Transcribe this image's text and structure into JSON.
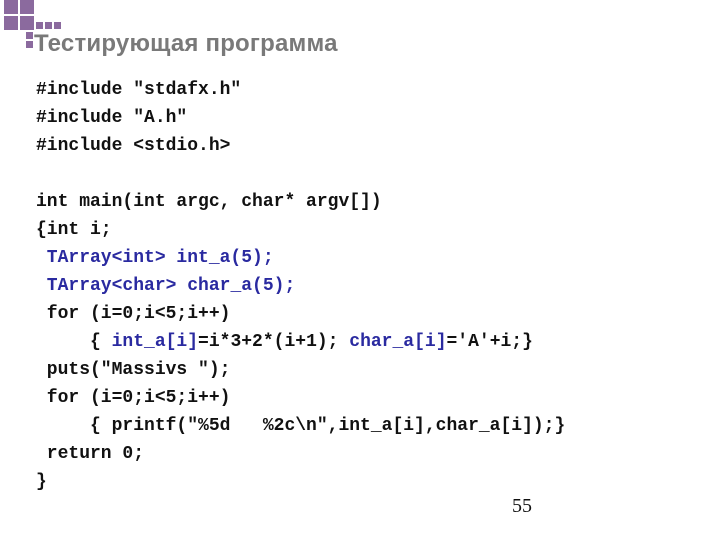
{
  "title": "Тестирующая программа",
  "page_number": "55",
  "code": {
    "l1": "#include \"stdafx.h\"",
    "l2": "#include \"A.h\"",
    "l3": "#include <stdio.h>",
    "l4": "",
    "l5": "int main(int argc, char* argv[])",
    "l6": "{int i;",
    "l7a": " TArray<int>",
    "l7b": " int_a(5);",
    "l8a": " TArray<char>",
    "l8b": " char_a(5);",
    "l9": " for (i=0;i<5;i++)",
    "l10a": "     { ",
    "l10b": "int_a[i]",
    "l10c": "=i*3+2*(i+1); ",
    "l10d": "char_a[i]",
    "l10e": "='A'+i;}",
    "l11": " puts(\"Massivs \");",
    "l12": " for (i=0;i<5;i++)",
    "l13": "     { printf(\"%5d   %2c\\n\",int_a[i],char_a[i]);}",
    "l14": " return 0;",
    "l15": "}"
  }
}
